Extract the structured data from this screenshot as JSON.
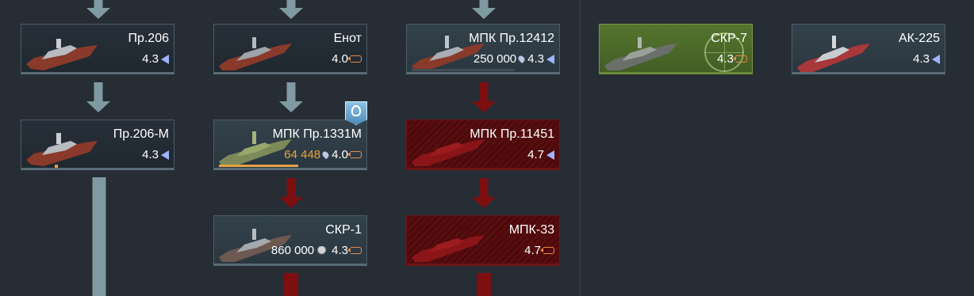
{
  "cards": {
    "pr206": {
      "name": "Пр.206",
      "br": "4.3",
      "icon": "triangle-icon"
    },
    "enot": {
      "name": "Енот",
      "br": "4.0",
      "icon": "premium-icon"
    },
    "mpk12412": {
      "name": "МПК Пр.12412",
      "cost": "250 000",
      "br": "4.3",
      "icon": "triangle-icon"
    },
    "skr7": {
      "name": "СКР-7",
      "br": "4.3",
      "icon": "premium-icon"
    },
    "ak225": {
      "name": "АК-225",
      "br": "4.3",
      "icon": "triangle-icon"
    },
    "pr206m": {
      "name": "Пр.206-М",
      "br": "4.3",
      "icon": "triangle-icon"
    },
    "mpk1331m": {
      "name": "МПК Пр.1331М",
      "cost": "64 448",
      "br": "4.0",
      "icon": "premium-icon",
      "research_progress": 0.48
    },
    "mpk11451": {
      "name": "МПК Пр.11451",
      "br": "4.7",
      "icon": "triangle-icon"
    },
    "skr1": {
      "name": "СКР-1",
      "cost": "860 000",
      "br": "4.3",
      "icon": "premium-icon"
    },
    "mpk33": {
      "name": "МПК-33",
      "br": "4.7",
      "icon": "premium-icon"
    }
  },
  "colors": {
    "background": "#262d35",
    "researched_arrow": "#7f9aa0",
    "locked_arrow": "#7e0f10",
    "locked_card": "#5a0d0f",
    "premium_card": "#55752e",
    "cost_orange": "#e8a83c",
    "br_triangle": "#9fb4ff",
    "premium_icon": "#e58c4a"
  }
}
